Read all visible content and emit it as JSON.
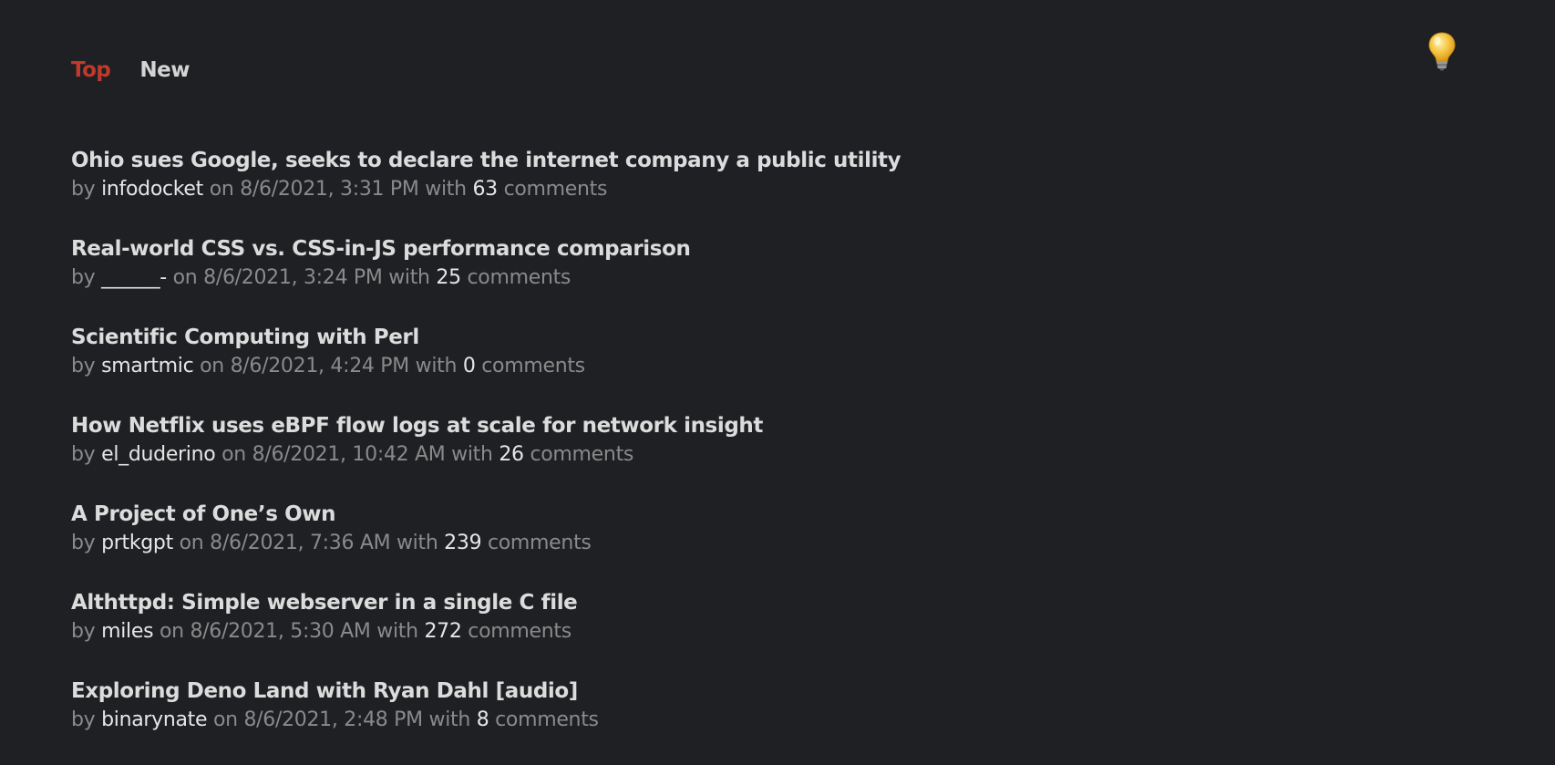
{
  "tabs": [
    {
      "label": "Top",
      "active": true
    },
    {
      "label": "New",
      "active": false
    }
  ],
  "theme_toggle": {
    "icon": "lightbulb-icon",
    "color": "#f5c542"
  },
  "meta_words": {
    "by": "by",
    "on": "on",
    "with": "with",
    "comments": "comments"
  },
  "stories": [
    {
      "title": "Ohio sues Google, seeks to declare the internet company a public utility",
      "user": "infodocket",
      "date": "8/6/2021, 3:31 PM",
      "comments": "63"
    },
    {
      "title": "Real-world CSS vs. CSS-in-JS performance comparison",
      "user": "______-",
      "date": "8/6/2021, 3:24 PM",
      "comments": "25"
    },
    {
      "title": "Scientific Computing with Perl",
      "user": "smartmic",
      "date": "8/6/2021, 4:24 PM",
      "comments": "0"
    },
    {
      "title": "How Netflix uses eBPF flow logs at scale for network insight",
      "user": "el_duderino",
      "date": "8/6/2021, 10:42 AM",
      "comments": "26"
    },
    {
      "title": "A Project of One’s Own",
      "user": "prtkgpt",
      "date": "8/6/2021, 7:36 AM",
      "comments": "239"
    },
    {
      "title": "Althttpd: Simple webserver in a single C file",
      "user": "miles",
      "date": "8/6/2021, 5:30 AM",
      "comments": "272"
    },
    {
      "title": "Exploring Deno Land with Ryan Dahl [audio]",
      "user": "binarynate",
      "date": "8/6/2021, 2:48 PM",
      "comments": "8"
    }
  ],
  "colors": {
    "background": "#1e2023",
    "accent": "#c0392b",
    "text": "#dcdcdc",
    "muted": "#8a8a8a"
  }
}
